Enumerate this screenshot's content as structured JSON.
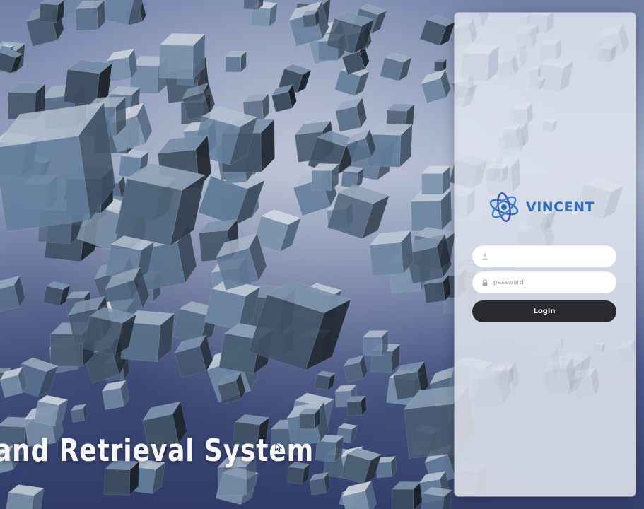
{
  "background": {
    "headline": "and Retrieval System",
    "sky_color": "#8a97b8",
    "cube_color": "#5d708f"
  },
  "login": {
    "brand_name": "VINCENT",
    "brand_color": "#2e6fc0",
    "username": {
      "value": "",
      "placeholder": "",
      "icon": "user-icon"
    },
    "password": {
      "value": "",
      "placeholder": "password",
      "icon": "lock-icon"
    },
    "submit_label": "Login",
    "button_color": "#2a2b2e"
  }
}
